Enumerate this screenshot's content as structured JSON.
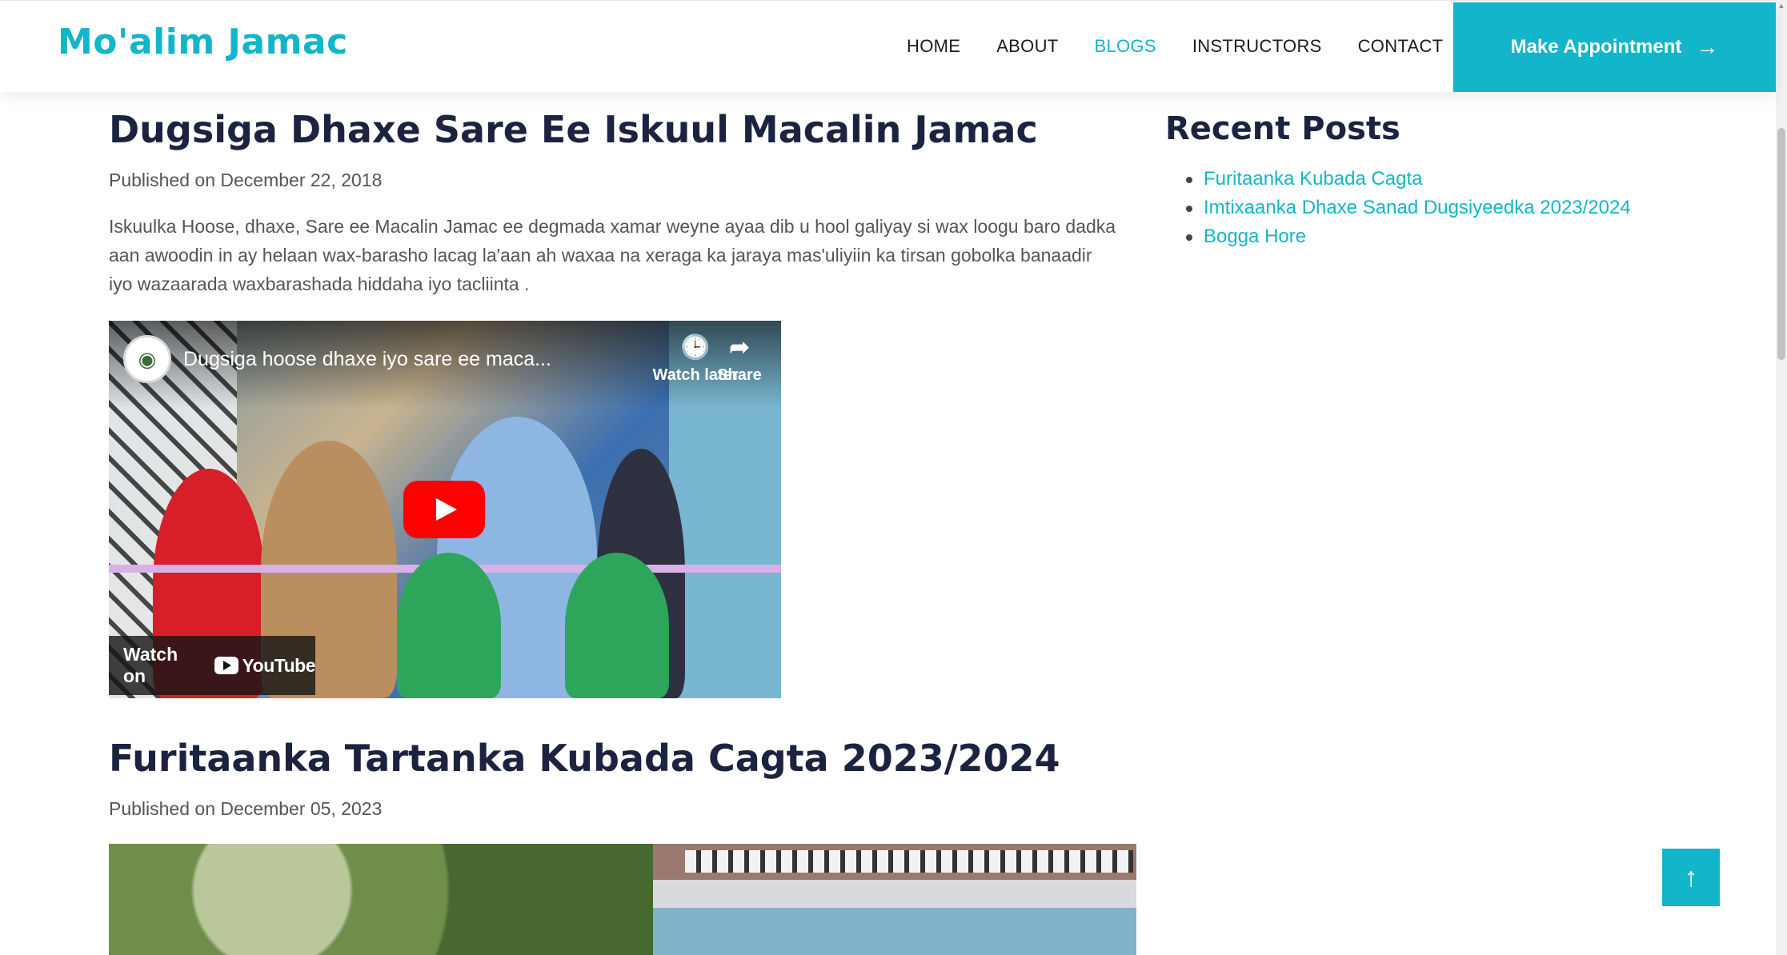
{
  "header": {
    "brand": "Mo'alim Jamac",
    "nav": [
      "HOME",
      "ABOUT",
      "BLOGS",
      "INSTRUCTORS",
      "CONTACT"
    ],
    "active_nav": "BLOGS",
    "cta_label": "Make Appointment",
    "cta_icon": "arrow-right-icon",
    "accent_color": "#12b5c9"
  },
  "posts": [
    {
      "title": "Dugsiga Dhaxe Sare Ee Iskuul Macalin Jamac",
      "meta": "Published on December 22, 2018",
      "body": "Iskuulka Hoose, dhaxe, Sare ee Macalin Jamac ee degmada xamar weyne ayaa dib u hool galiyay si wax loogu baro dadka aan awoodin in ay helaan wax-barasho lacag la'aan ah waxaa na xeraga ka jaraya mas'uliyiin ka tirsan gobolka banaadir iyo wazaarada waxbarashada hiddaha iyo tacliinta .",
      "video": {
        "title": "Dugsiga hoose dhaxe iyo sare ee maca...",
        "watch_later": "Watch later",
        "share": "Share",
        "watch_on": "Watch on",
        "youtube": "YouTube"
      }
    },
    {
      "title": "Furitaanka Tartanka Kubada Cagta 2023/2024",
      "meta": "Published on December 05, 2023"
    }
  ],
  "sidebar": {
    "title": "Recent Posts",
    "items": [
      "Furitaanka Kubada Cagta",
      "Imtixaanka Dhaxe Sanad Dugsiyeedka 2023/2024",
      "Bogga Hore"
    ]
  },
  "back_to_top_icon": "arrow-up-icon"
}
